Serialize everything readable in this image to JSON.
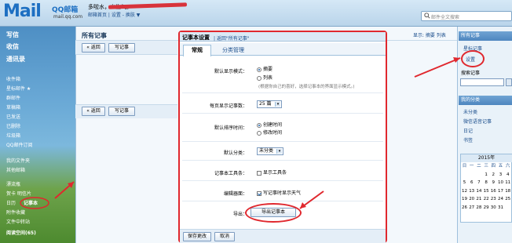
{
  "header": {
    "logo": "Mail",
    "logo_zh": "QQ邮箱",
    "logo_url": "mail.qq.com",
    "user_name": "多啦水，少生气。",
    "top_links": "邮箱首页 | 设置 - 换肤 ▼",
    "search_placeholder": "邮件全文搜索"
  },
  "sidebar": {
    "compose": "写信",
    "inbox": "收信",
    "contacts": "通讯录",
    "folders": [
      "收件箱",
      "星标邮件 ★",
      "群邮件",
      "草稿箱",
      "已发送",
      "已删除",
      "垃圾箱",
      "QQ邮件订阅"
    ],
    "my_folders": "我的文件夹",
    "other_mail": "其他邮箱",
    "more_apps": "记事本 · 日历 · 附件收藏 · 文件中转站 · 贺卡 · 明信片 · 阅读空间",
    "extras": [
      "漂流瓶",
      "贺卡  明信片",
      "日历",
      "记事本",
      "附件收藏",
      "文件中转站"
    ],
    "read_space": "阅读空间(65)"
  },
  "main": {
    "title": "所有记事",
    "right_links": "显示: 摘要 列表",
    "back": "« 返回",
    "write": "写记事"
  },
  "dialog": {
    "title": "记事本设置",
    "back_link": "| 返回\"所有记事\"",
    "tabs": [
      "常规",
      "分类管理"
    ],
    "rows": {
      "display_label": "默认显示模式：",
      "display_options": [
        "摘要",
        "列表"
      ],
      "display_hint": "(根据你自己的喜好，选择记事本的界面显示模式。)",
      "per_page_label": "每页显示记事数：",
      "per_page_value": "25 篇",
      "sort_label": "默认排序时间：",
      "sort_options": [
        "创建时间",
        "修改时间"
      ],
      "category_label": "默认分类：",
      "category_value": "未分类",
      "toolbar_label": "记事本工具条：",
      "toolbar_option": "显示工具条",
      "editor_label": "编辑器面：",
      "editor_option": "写记事时显示天气",
      "export_label": "导出：",
      "export_button": "导出记事本"
    },
    "save": "保存更改",
    "cancel": "取消"
  },
  "right_panel": {
    "all_notes": "所有记事",
    "starred": "星标记事",
    "settings": "设置",
    "search": "搜索记事",
    "categories_head": "我的分类",
    "categories": [
      "未分类",
      "微信语音记事",
      "日记",
      "书签"
    ],
    "calendar_title": "2015年",
    "calendar_days": [
      "日",
      "一",
      "二",
      "三",
      "四",
      "五",
      "六",
      "",
      "",
      "",
      "1",
      "2",
      "3",
      "4",
      "5",
      "6",
      "7",
      "8",
      "9",
      "10",
      "11",
      "12",
      "13",
      "14",
      "15",
      "16",
      "17",
      "18",
      "19",
      "20",
      "21",
      "22",
      "23",
      "24",
      "25",
      "26",
      "27",
      "28",
      "29",
      "30",
      "31"
    ]
  },
  "colors": {
    "accent": "#e0282e",
    "link": "#1a4d8c",
    "header": "#4e86bf"
  }
}
